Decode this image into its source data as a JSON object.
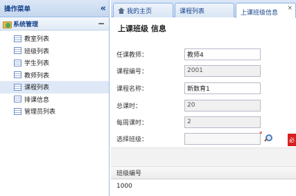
{
  "sidebar": {
    "title": "操作菜单",
    "collapse_glyph": "«",
    "group": {
      "label": "系统管理",
      "toggle": "−"
    },
    "items": [
      {
        "label": "教室列表",
        "active": false
      },
      {
        "label": "班级列表",
        "active": false
      },
      {
        "label": "学生列表",
        "active": false
      },
      {
        "label": "教师列表",
        "active": false
      },
      {
        "label": "课程列表",
        "active": true
      },
      {
        "label": "排课信息",
        "active": false
      },
      {
        "label": "管理员列表",
        "active": false
      }
    ]
  },
  "tabs": [
    {
      "label": "我的主页",
      "icon": "home-icon"
    },
    {
      "label": "课程列表"
    },
    {
      "label": "上课班级信息",
      "active": true,
      "close": "×"
    }
  ],
  "form": {
    "title": "上课班级 信息",
    "fields": [
      {
        "label": "任课教师：",
        "value": "教师4"
      },
      {
        "label": "课程编号：",
        "value": "2001"
      },
      {
        "label": "课程名称：",
        "value": "新数育1"
      },
      {
        "label": "总课时：",
        "value": "20"
      },
      {
        "label": "每周课时：",
        "value": "2"
      },
      {
        "label": "选择班级：",
        "value": ""
      }
    ],
    "required_mark": "*",
    "badge_text": "必"
  },
  "grid": {
    "columns": [
      "班级编号"
    ],
    "rows": [
      [
        "1000"
      ]
    ]
  },
  "colors": {
    "accent": "#15428b",
    "border": "#99bbe8",
    "required": "#e00000",
    "badge": "#d81e1e"
  }
}
